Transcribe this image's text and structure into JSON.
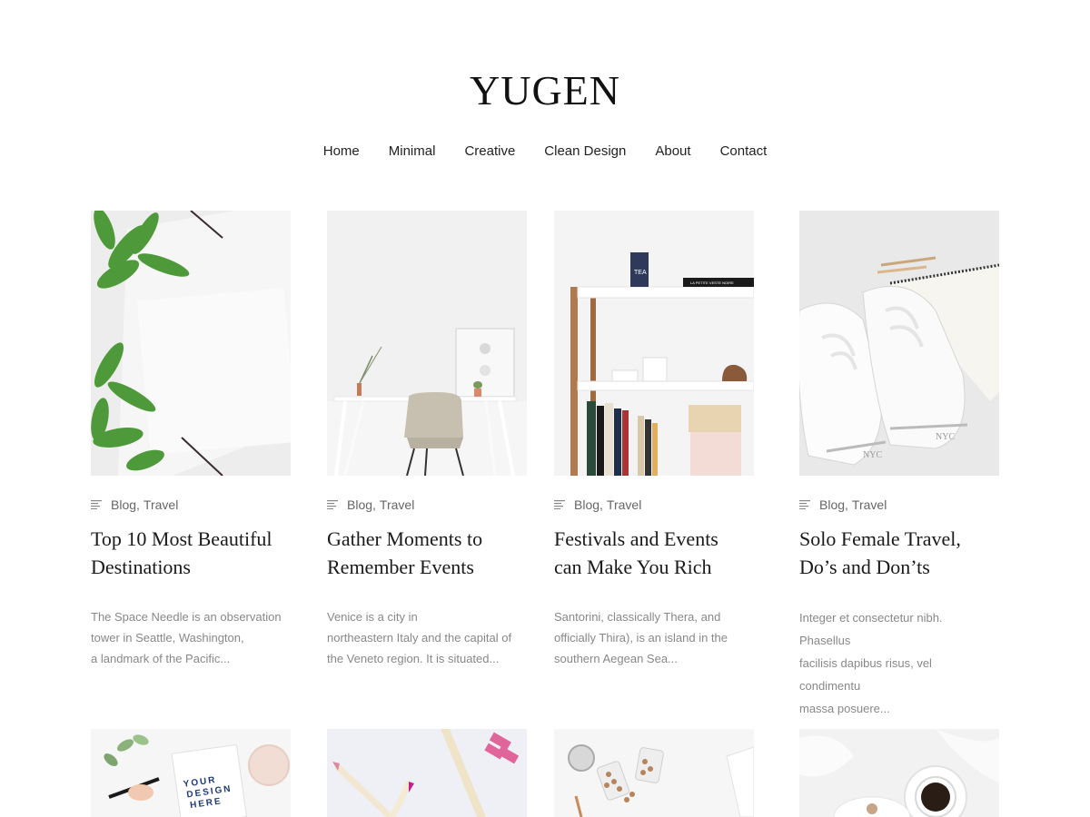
{
  "site": {
    "logo": "YUGEN"
  },
  "nav": {
    "items": [
      {
        "label": "Home"
      },
      {
        "label": "Minimal"
      },
      {
        "label": "Creative"
      },
      {
        "label": "Clean Design"
      },
      {
        "label": "About"
      },
      {
        "label": "Contact"
      }
    ]
  },
  "posts": [
    {
      "cat1": "Blog",
      "cat2": "Travel",
      "title_line1": "Top 10 Most Beautiful",
      "title_line2": "Destinations",
      "excerpt_line1": "The Space Needle is an observation",
      "excerpt_line2": "tower in Seattle, Washington,",
      "excerpt_line3": "a landmark of the Pacific..."
    },
    {
      "cat1": "Blog",
      "cat2": "Travel",
      "title_line1": "Gather Moments to",
      "title_line2": "Remember Events",
      "excerpt_line1": "Venice is a city in",
      "excerpt_line2": "northeastern Italy and the capital of",
      "excerpt_line3": "the Veneto region. It is situated..."
    },
    {
      "cat1": "Blog",
      "cat2": "Travel",
      "title_line1": "Festivals and Events",
      "title_line2": "can Make You Rich",
      "excerpt_line1": "Santorini, classically Thera, and",
      "excerpt_line2": "officially Thira), is an island in the",
      "excerpt_line3": "southern Aegean Sea..."
    },
    {
      "cat1": "Blog",
      "cat2": "Travel",
      "title_line1": "Solo Female Travel,",
      "title_line2": "Do’s and Don’ts",
      "excerpt_line1": "Integer et consectetur nibh. Phasellus",
      "excerpt_line2": "facilisis dapibus risus, vel condimentu",
      "excerpt_line3": "massa posuere..."
    }
  ],
  "row2_images": {
    "mockup_text_line1": "YOUR",
    "mockup_text_line2": "DESIGN",
    "mockup_text_line3": "HERE"
  },
  "thumb_labels": {
    "book_label": "TEA",
    "book2_label": "LA PETITE VESTE NOIRE",
    "shoe_brand": "NYC"
  },
  "colors": {
    "text_dark": "#1a1a1a",
    "meta_gray": "#666666",
    "excerpt_gray": "#888888",
    "background": "#ffffff"
  }
}
